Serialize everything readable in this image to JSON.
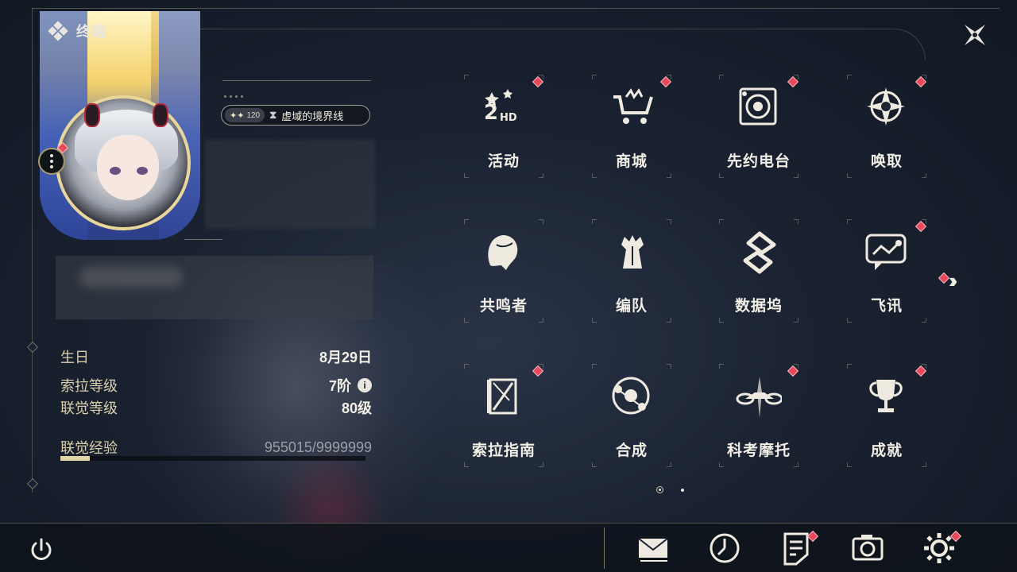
{
  "header": {
    "title": "终端"
  },
  "profile": {
    "level_badge": "120",
    "signature": "虚域的境界线",
    "stats": [
      {
        "label": "生日",
        "value": "8月29日"
      },
      {
        "label": "索拉等级",
        "value": "7阶"
      },
      {
        "label": "联觉等级",
        "value": "80级"
      }
    ],
    "exp": {
      "label": "联觉经验",
      "value": "955015/9999999",
      "progress": 0.0955
    }
  },
  "menu": [
    {
      "label": "活动",
      "icon": "event-2hd-icon",
      "badge": true
    },
    {
      "label": "商城",
      "icon": "shop-cart-icon",
      "badge": true
    },
    {
      "label": "先约电台",
      "icon": "radio-icon",
      "badge": true
    },
    {
      "label": "唤取",
      "icon": "convene-compass-icon",
      "badge": true
    },
    {
      "label": "共鸣者",
      "icon": "resonator-head-icon",
      "badge": false
    },
    {
      "label": "编队",
      "icon": "team-chess-icon",
      "badge": false
    },
    {
      "label": "数据坞",
      "icon": "data-dock-icon",
      "badge": false
    },
    {
      "label": "飞讯",
      "icon": "message-chat-icon",
      "badge": true
    },
    {
      "label": "索拉指南",
      "icon": "guidebook-icon",
      "badge": true
    },
    {
      "label": "合成",
      "icon": "synthesis-icon",
      "badge": false
    },
    {
      "label": "科考摩托",
      "icon": "motorbike-icon",
      "badge": true
    },
    {
      "label": "成就",
      "icon": "trophy-icon",
      "badge": true
    }
  ],
  "pager": {
    "current": 1,
    "total": 2
  },
  "bottom_bar": [
    {
      "name": "mail-icon",
      "badge": false
    },
    {
      "name": "clock-icon",
      "badge": false
    },
    {
      "name": "notice-icon",
      "badge": true
    },
    {
      "name": "camera-icon",
      "badge": false
    },
    {
      "name": "settings-icon",
      "badge": true
    }
  ],
  "colors": {
    "accent": "#d9cfae",
    "badge": "#e8485a",
    "background": "#1a2231"
  }
}
